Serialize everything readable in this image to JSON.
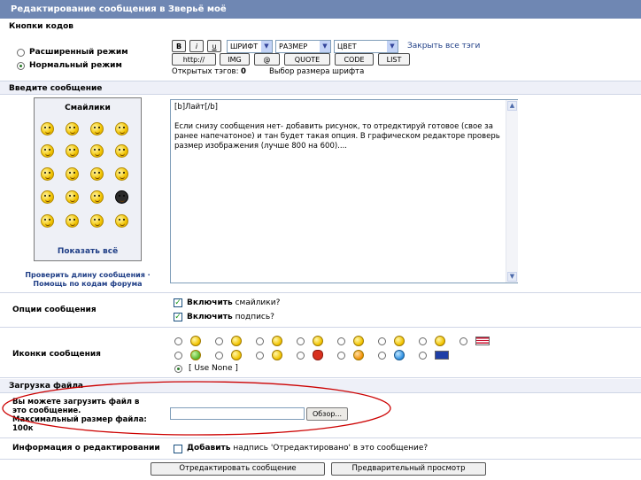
{
  "window": {
    "title": "Редактирование сообщения в Зверьё моё"
  },
  "codes": {
    "section_label": "Кнопки кодов",
    "modes": [
      {
        "label": "Расширенный режим",
        "selected": false
      },
      {
        "label": "Нормальный режим",
        "selected": true
      }
    ],
    "buttons_row1": [
      "B",
      "i",
      "u"
    ],
    "font_select": "ШРИФТ",
    "size_select": "РАЗМЕР",
    "color_select": "ЦВЕТ",
    "close_tags": "Закрыть все тэги",
    "buttons_row2": [
      "http://",
      "IMG",
      "@",
      "QUOTE",
      "CODE",
      "LIST"
    ],
    "open_tags_label": "Открытых тэгов:",
    "open_tags_count": "0",
    "hint": "Выбор размера шрифта"
  },
  "message": {
    "section_label": "Введите сообщение",
    "smilies_title": "Смайлики",
    "show_all": "Показать всё",
    "check_length": "Проверить длину сообщения",
    "help_codes": "Помощь по кодам форума",
    "bullet": "·",
    "text": "[b]Лайт[/b]\n\nЕсли снизу сообщения нет- добавить рисунок, то отредктируй готовое (свое за ранее напечатоное) и тан будет такая опция. В графическом редакторе проверь размер изображения (лучше 800 на 600)...."
  },
  "options": {
    "label": "Опции сообщения",
    "smilies_on": "Включить",
    "smilies_rest": "смайлики?",
    "signature_on": "Включить",
    "signature_rest": "подпись?"
  },
  "icons": {
    "label": "Иконки сообщения",
    "use_none": "[ Use None ]",
    "row1": [
      "smile-icon",
      "grin-icon",
      "meh-icon",
      "wink-icon",
      "surprised-icon",
      "happy-icon",
      "angry-icon",
      "usa-flag-icon"
    ],
    "row2": [
      "green-face-icon",
      "cool-icon",
      "arrow-icon",
      "heart-icon",
      "exclaim-icon",
      "question-icon",
      "eu-flag-icon"
    ]
  },
  "upload": {
    "section_label": "Загрузка файла",
    "desc_line1": "Вы можете загрузить файл в",
    "desc_line2": "это сообщение.",
    "desc_line3": "Максимальный размер файла:",
    "desc_line4": "100к",
    "browse": "Обзор..."
  },
  "edit_info": {
    "label": "Информация о редактировании",
    "add": "Добавить",
    "rest": "надпись 'Отредактировано' в это сообщение?"
  },
  "actions": {
    "submit": "Отредактировать сообщение",
    "preview": "Предварительный просмотр"
  },
  "colors": {
    "header": "#6f87b3",
    "section": "#eef0f8",
    "annotation": "#cc0000"
  }
}
